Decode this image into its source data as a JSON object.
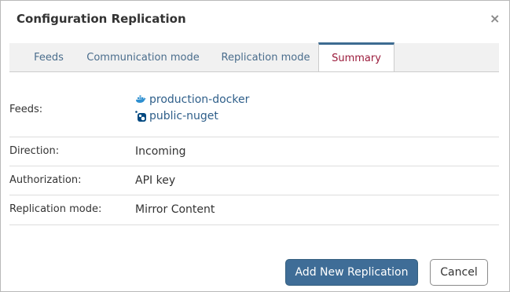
{
  "dialog": {
    "title": "Configuration Replication",
    "close_icon": "×"
  },
  "tabs": [
    {
      "label": "Feeds",
      "active": false
    },
    {
      "label": "Communication mode",
      "active": false
    },
    {
      "label": "Replication mode",
      "active": false
    },
    {
      "label": "Summary",
      "active": true
    }
  ],
  "summary": {
    "feeds_label": "Feeds:",
    "feeds": [
      {
        "name": "production-docker",
        "icon": "docker-icon"
      },
      {
        "name": "public-nuget",
        "icon": "nuget-icon"
      }
    ],
    "direction_label": "Direction:",
    "direction_value": "Incoming",
    "authorization_label": "Authorization:",
    "authorization_value": "API key",
    "replication_mode_label": "Replication mode:",
    "replication_mode_value": "Mirror Content"
  },
  "buttons": {
    "add_label": "Add New Replication",
    "cancel_label": "Cancel"
  },
  "colors": {
    "accent": "#3f6d97",
    "active_tab_text": "#9b1b3b",
    "link": "#2f5f8a",
    "docker_icon": "#2e8fd0",
    "nuget_icon": "#004880"
  }
}
